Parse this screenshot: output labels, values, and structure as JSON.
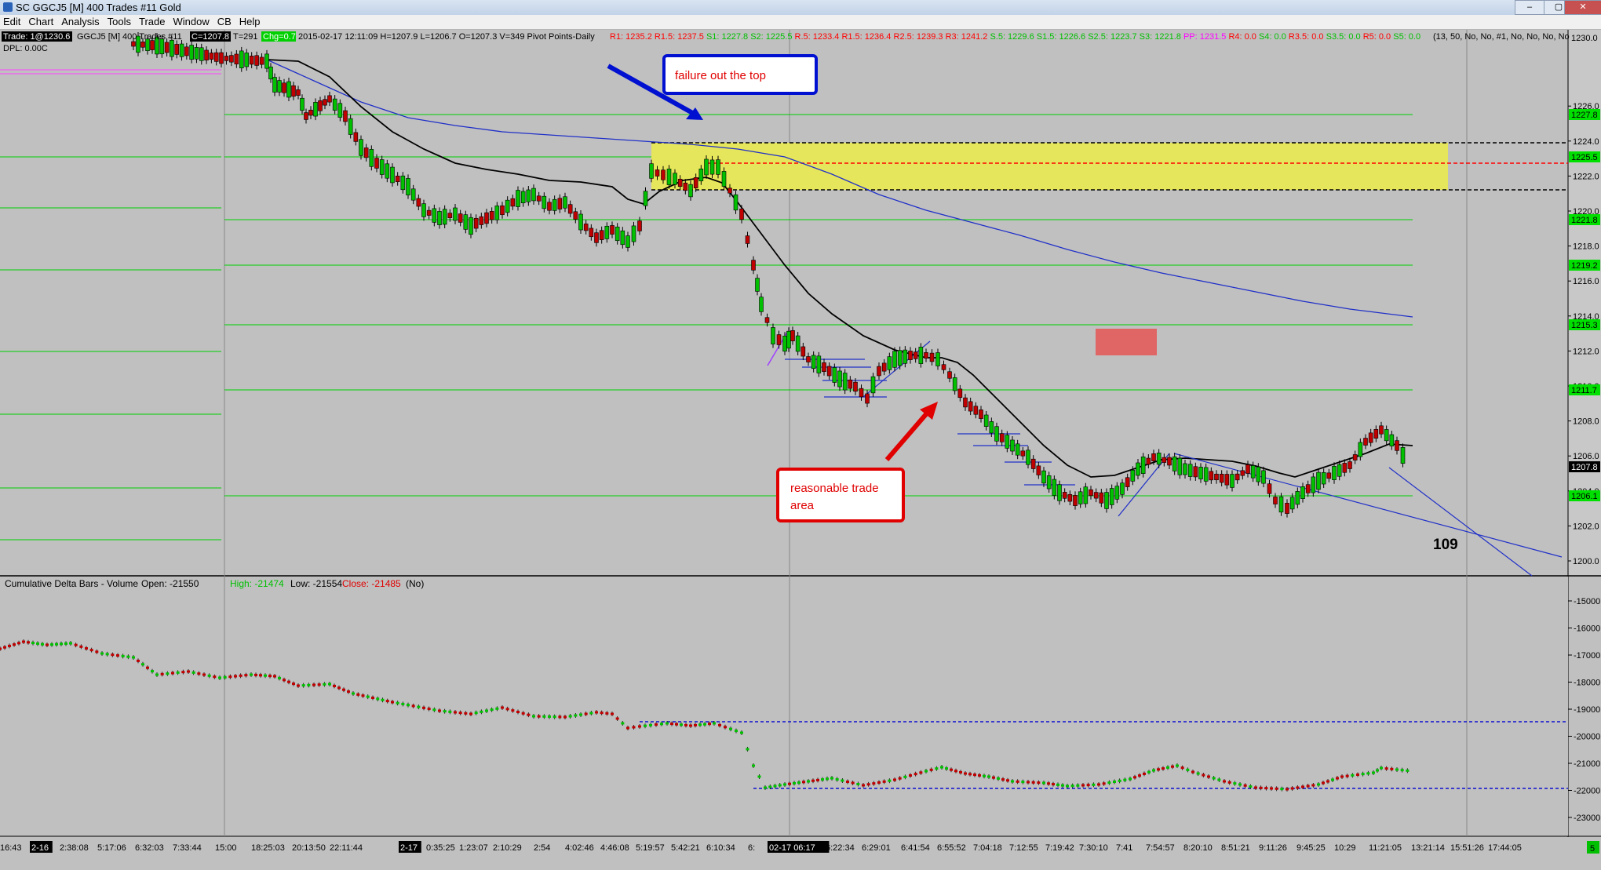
{
  "window": {
    "title": "SC GGCJ5 [M]  400 Trades  #11  Gold",
    "minimize": "–",
    "maximize": "▢",
    "close": "✕"
  },
  "menu": [
    "Edit",
    "Chart",
    "Analysis",
    "Tools",
    "Trade",
    "Window",
    "CB",
    "Help"
  ],
  "price_header": {
    "trade_label": "Trade: 1@1230.6",
    "symbol": "GGCJ5 [M]  400 Trades  #11",
    "last": "C=1207.8",
    "t": "T=291",
    "chg": "Chg=0.7",
    "bar_info": "2015-02-17 12:11:09  H=1207.9  L=1206.7  O=1207.3  V=349  Pivot Points-Daily",
    "pivots": [
      {
        "label": "R1: 1235.2",
        "color": "#ff0000"
      },
      {
        "label": "R1.5: 1237.5",
        "color": "#ff0000"
      },
      {
        "label": "S1: 1227.8",
        "color": "#00c000"
      },
      {
        "label": "S2: 1225.5",
        "color": "#00c000"
      },
      {
        "label": "R.5: 1233.4",
        "color": "#ff0000"
      },
      {
        "label": "R1.5: 1236.4",
        "color": "#ff0000"
      },
      {
        "label": "R2.5: 1239.3",
        "color": "#ff0000"
      },
      {
        "label": "R3: 1241.2",
        "color": "#ff0000"
      },
      {
        "label": "S.5: 1229.6",
        "color": "#00c000"
      },
      {
        "label": "S1.5: 1226.6",
        "color": "#00c000"
      },
      {
        "label": "S2.5: 1223.7",
        "color": "#00c000"
      },
      {
        "label": "S3: 1221.8",
        "color": "#00c000"
      },
      {
        "label": "PP: 1231.5",
        "color": "#ff00ff"
      },
      {
        "label": "R4: 0.0",
        "color": "#ff0000"
      },
      {
        "label": "S4: 0.0",
        "color": "#00c000"
      },
      {
        "label": "R3.5: 0.0",
        "color": "#ff0000"
      },
      {
        "label": "S3.5: 0.0",
        "color": "#00c000"
      },
      {
        "label": "R5: 0.0",
        "color": "#ff0000"
      },
      {
        "label": "S5: 0.0",
        "color": "#00c000"
      }
    ],
    "params": "(13, 50, No, No, #1, No, No, No, No"
  },
  "dpl": "DPL: 0.00C",
  "annotations": {
    "top_callout": "failure out the top",
    "trade_callout_line1": "reasonable trade",
    "trade_callout_line2": "area",
    "count": "109"
  },
  "price_axis": {
    "top_label": "1230.0",
    "ticks": [
      "1226.0",
      "1224.0",
      "1222.0",
      "1220.0",
      "1218.0",
      "1216.0",
      "1214.0",
      "1212.0",
      "1210.0",
      "1208.0",
      "1206.0",
      "1204.0",
      "1202.0",
      "1200.0"
    ],
    "badges": [
      {
        "label": "1227.8",
        "color": "#00e000"
      },
      {
        "label": "1225.5",
        "color": "#00e000"
      },
      {
        "label": "1221.8",
        "color": "#00e000"
      },
      {
        "label": "1219.2",
        "color": "#00e000"
      },
      {
        "label": "1215.3",
        "color": "#00e000"
      },
      {
        "label": "1211.7",
        "color": "#00e000"
      },
      {
        "label": "1207.8",
        "color": "#000000"
      },
      {
        "label": "1206.1",
        "color": "#00e000"
      }
    ]
  },
  "delta_panel": {
    "title": "Cumulative Delta Bars - Volume",
    "open": "Open: -21550",
    "high": "High: -21474",
    "low": "Low: -21554",
    "close": "Close: -21485",
    "flag": "(No)",
    "ticks": [
      "-15000",
      "-16000",
      "-17000",
      "-18000",
      "-19000",
      "-20000",
      "-21000",
      "-22000",
      "-23000"
    ]
  },
  "time_axis": {
    "labels": [
      "16:43",
      "2-16",
      "2:38:08",
      "5:17:06",
      "6:32:03",
      "7:33:44",
      "15:00",
      "18:25:03",
      "20:13:50",
      "22:11:44",
      "2-17",
      "0:35:25",
      "1:23:07",
      "2:10:29",
      "2:54",
      "4:02:46",
      "4:46:08",
      "5:19:57",
      "5:42:21",
      "6:10:34",
      "6:",
      "02-17  06:17",
      "6:22:34",
      "6:29:01",
      "6:41:54",
      "6:55:52",
      "7:04:18",
      "7:12:55",
      "7:19:42",
      "7:30:10",
      "7:41",
      "7:54:57",
      "8:20:10",
      "8:51:21",
      "9:11:26",
      "9:45:25",
      "10:29",
      "11:21:05",
      "13:21:14",
      "15:51:26",
      "17:44:05"
    ],
    "corner": "5"
  },
  "colors": {
    "background": "#c0c0c0",
    "up_candle": "#00c000",
    "down_candle": "#c00000",
    "pivot_green": "#00d000",
    "zone_yellow": "#e6e65c",
    "short_ma": "#000000",
    "long_ma": "#2030c8",
    "callout_blue": "#0000e0",
    "callout_red": "#e00000",
    "delta_line": "#0000c0"
  }
}
